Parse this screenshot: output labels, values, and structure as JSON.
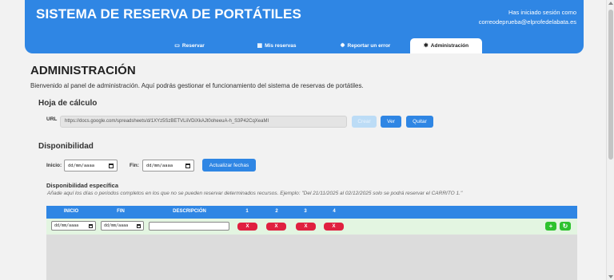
{
  "app": {
    "title": "SISTEMA DE RESERVA DE PORTÁTILES",
    "session_label": "Has iniciado sesión como",
    "session_email": "correodeprueba@elprofedelabata.es"
  },
  "nav": {
    "tabs": [
      {
        "icon": "laptop-icon",
        "glyph": "▭",
        "label": "Reservar"
      },
      {
        "icon": "calendar-icon",
        "glyph": "▦",
        "label": "Mis reservas"
      },
      {
        "icon": "bug-icon",
        "glyph": "✹",
        "label": "Reportar un error"
      },
      {
        "icon": "gear-icon",
        "glyph": "✱",
        "label": "Administración",
        "active": true
      }
    ]
  },
  "page": {
    "title": "ADMINISTRACIÓN",
    "welcome": "Bienvenido al panel de administración. Aquí podrás gestionar el funcionamiento del sistema de reservas de portátiles."
  },
  "spreadsheet": {
    "section_title": "Hoja de cálculo",
    "url_label": "URL",
    "url_value": "https://docs.google.com/spreadsheets/d/1XYz5SzBETVLiiVDiXkAJt0oheeuA-h_S3P42CqXeaMI",
    "save_label": "Crear",
    "view_label": "Ver",
    "remove_label": "Quitar"
  },
  "availability": {
    "section_title": "Disponibilidad",
    "start_label": "Inicio:",
    "start_placeholder": "dd/mm/aaaa",
    "end_label": "Fin:",
    "end_placeholder": "dd/mm/aaaa",
    "update_label": "Actualizar fechas",
    "specific_title": "Disponibilidad específica",
    "specific_hint": "Añade aquí los días o periodos completos en los que no se pueden reservar determinados recursos. Ejemplo: \"Del 21/11/2025 al 02/12/2025 solo se podrá reservar el CARRITO 1.\""
  },
  "table": {
    "headers": [
      "INICIO",
      "FIN",
      "DESCRIPCIÓN",
      "1",
      "2",
      "3",
      "4"
    ],
    "row": {
      "start_placeholder": "dd/mm/aaaa",
      "end_placeholder": "dd/mm/aaaa",
      "description": "",
      "resource_buttons": [
        "X",
        "X",
        "X",
        "X"
      ],
      "add_label": "+",
      "refresh_label": "↻"
    }
  },
  "colors": {
    "primary": "#2f86e4",
    "danger": "#e02040",
    "success": "#2ec22e",
    "row_bg": "#e3f5e1"
  }
}
